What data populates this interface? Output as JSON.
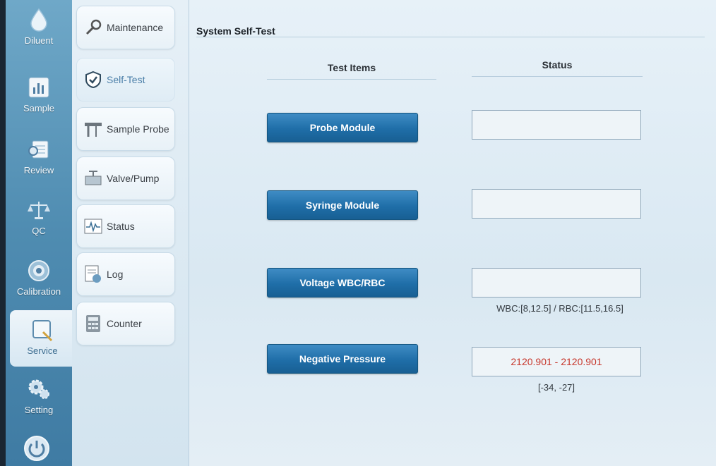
{
  "nav": {
    "items": [
      {
        "label": "Diluent",
        "icon": "diluent-drop-icon"
      },
      {
        "label": "Sample",
        "icon": "sample-chart-icon"
      },
      {
        "label": "Review",
        "icon": "review-table-icon"
      },
      {
        "label": "QC",
        "icon": "qc-scale-icon"
      },
      {
        "label": "Calibration",
        "icon": "calibration-target-icon"
      },
      {
        "label": "Service",
        "icon": "service-wrench-icon"
      },
      {
        "label": "Setting",
        "icon": "setting-gears-icon"
      }
    ],
    "active": "Service"
  },
  "subnav": {
    "items": [
      {
        "label": "Maintenance",
        "icon": "wrench-icon"
      },
      {
        "label": "Self-Test",
        "icon": "check-shield-icon"
      },
      {
        "label": "Sample Probe",
        "icon": "probe-icon"
      },
      {
        "label": "Valve/Pump",
        "icon": "valve-icon"
      },
      {
        "label": "Status",
        "icon": "waveform-icon"
      },
      {
        "label": "Log",
        "icon": "log-icon"
      },
      {
        "label": "Counter",
        "icon": "counter-icon"
      }
    ],
    "active": "Self-Test"
  },
  "main": {
    "title": "System Self-Test",
    "col_test_items": "Test Items",
    "col_status": "Status",
    "tests": [
      {
        "label": "Probe Module",
        "status": "",
        "range": ""
      },
      {
        "label": "Syringe Module",
        "status": "",
        "range": ""
      },
      {
        "label": "Voltage WBC/RBC",
        "status": "",
        "range": "WBC:[8,12.5] / RBC:[11.5,16.5]"
      },
      {
        "label": "Negative Pressure",
        "status": "2120.901 - 2120.901",
        "range": "[-34, -27]"
      }
    ]
  },
  "colors": {
    "button_blue": "#1f6ea8",
    "status_red": "#c7362b",
    "nav_blue": "#4f8cb1"
  }
}
